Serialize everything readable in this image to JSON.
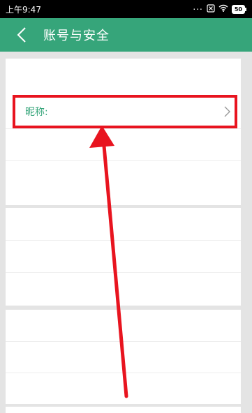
{
  "status_bar": {
    "time": "上午9:47",
    "dots": "...",
    "battery": "50"
  },
  "header": {
    "title": "账号与安全"
  },
  "settings": {
    "nickname_label": "昵称:"
  },
  "colors": {
    "header_bg": "#36a57a",
    "accent_text": "#36a57a",
    "annotation_red": "#e8141f",
    "page_bg": "#e4e4e4"
  },
  "icons": {
    "back": "chevron-left-icon",
    "row_arrow": "chevron-right-icon",
    "wifi": "wifi-icon",
    "sim": "sim-icon",
    "battery": "battery-icon"
  }
}
